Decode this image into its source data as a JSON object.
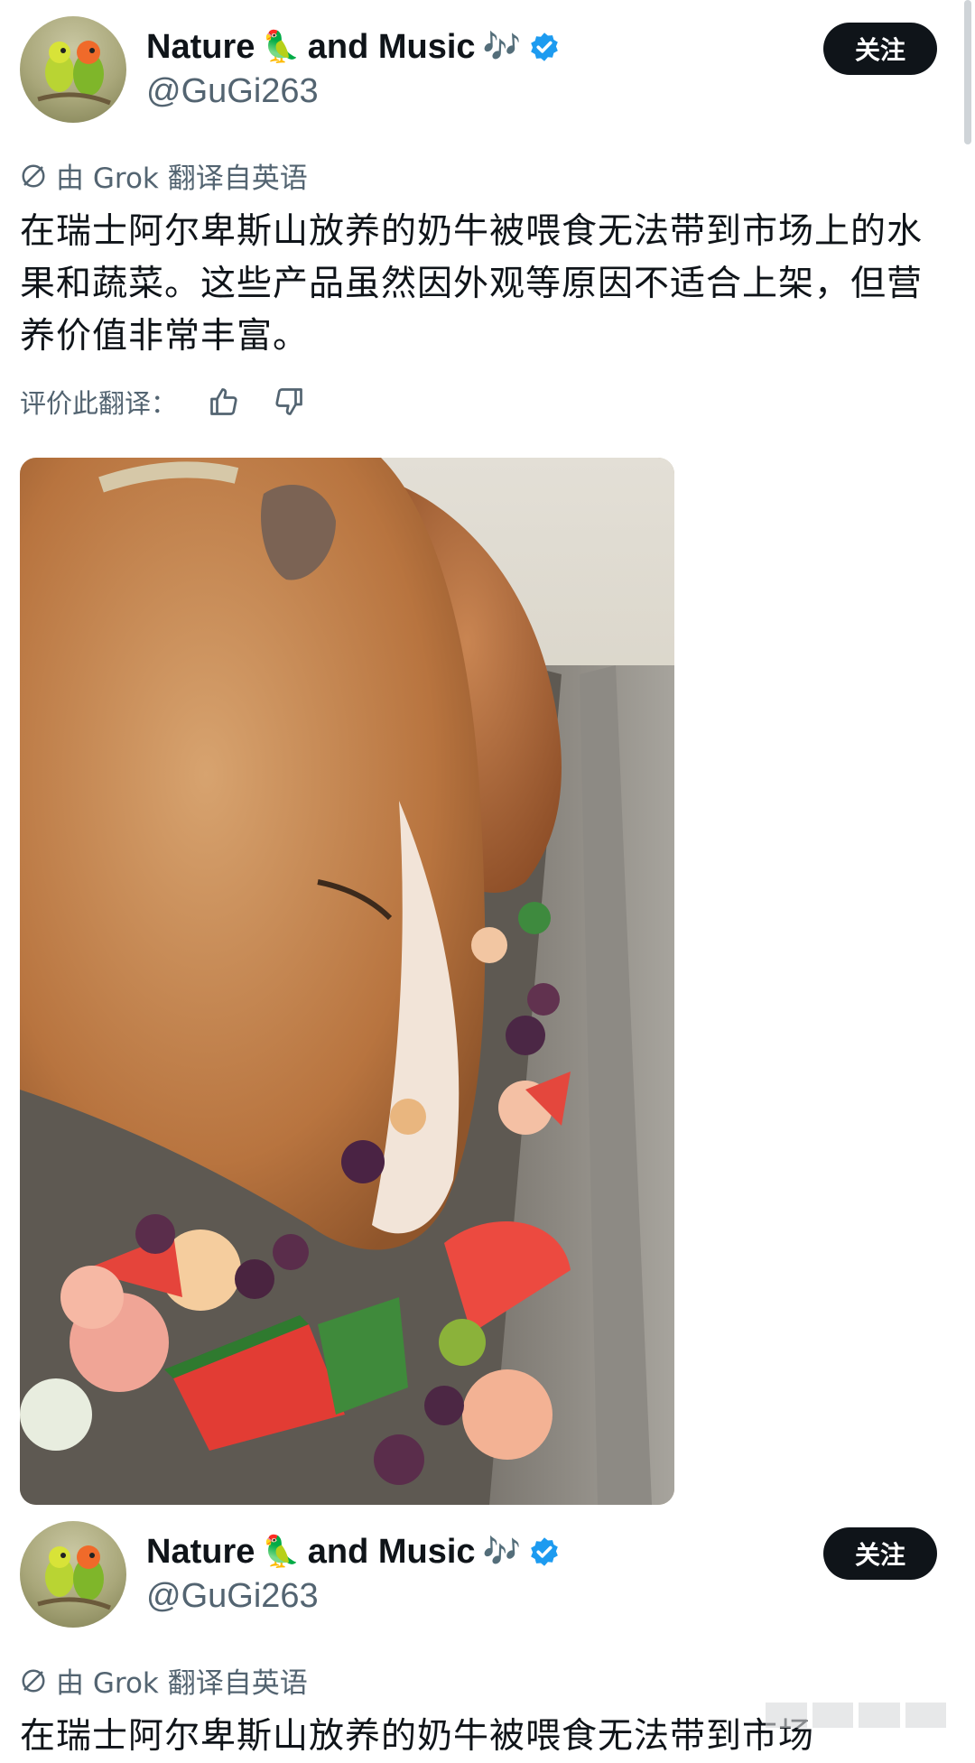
{
  "posts": [
    {
      "author_name": "Nature",
      "author_name_suffix": "and Music",
      "parrot_emoji": "🦜",
      "music_emoji": "🎶",
      "handle": "@GuGi263",
      "follow_label": "关注",
      "grok_label": "由 Grok 翻译自英语",
      "text": "在瑞士阿尔卑斯山放养的奶牛被喂食无法带到市场上的水果和蔬菜。这些产品虽然因外观等原因不适合上架，但营养价值非常丰富。",
      "rate_label": "评价此翻译："
    },
    {
      "author_name": "Nature",
      "author_name_suffix": "and Music",
      "parrot_emoji": "🦜",
      "music_emoji": "🎶",
      "handle": "@GuGi263",
      "follow_label": "关注",
      "grok_label": "由 Grok 翻译自英语",
      "text": "在瑞士阿尔卑斯山放养的奶牛被喂食无法带到市场"
    }
  ],
  "colors": {
    "accent": "#1d9bf0",
    "text": "#0f1419",
    "muted": "#536471",
    "button": "#0f1419"
  },
  "icons": [
    "verified-badge-icon",
    "translate-icon",
    "thumbs-up-icon",
    "thumbs-down-icon"
  ]
}
